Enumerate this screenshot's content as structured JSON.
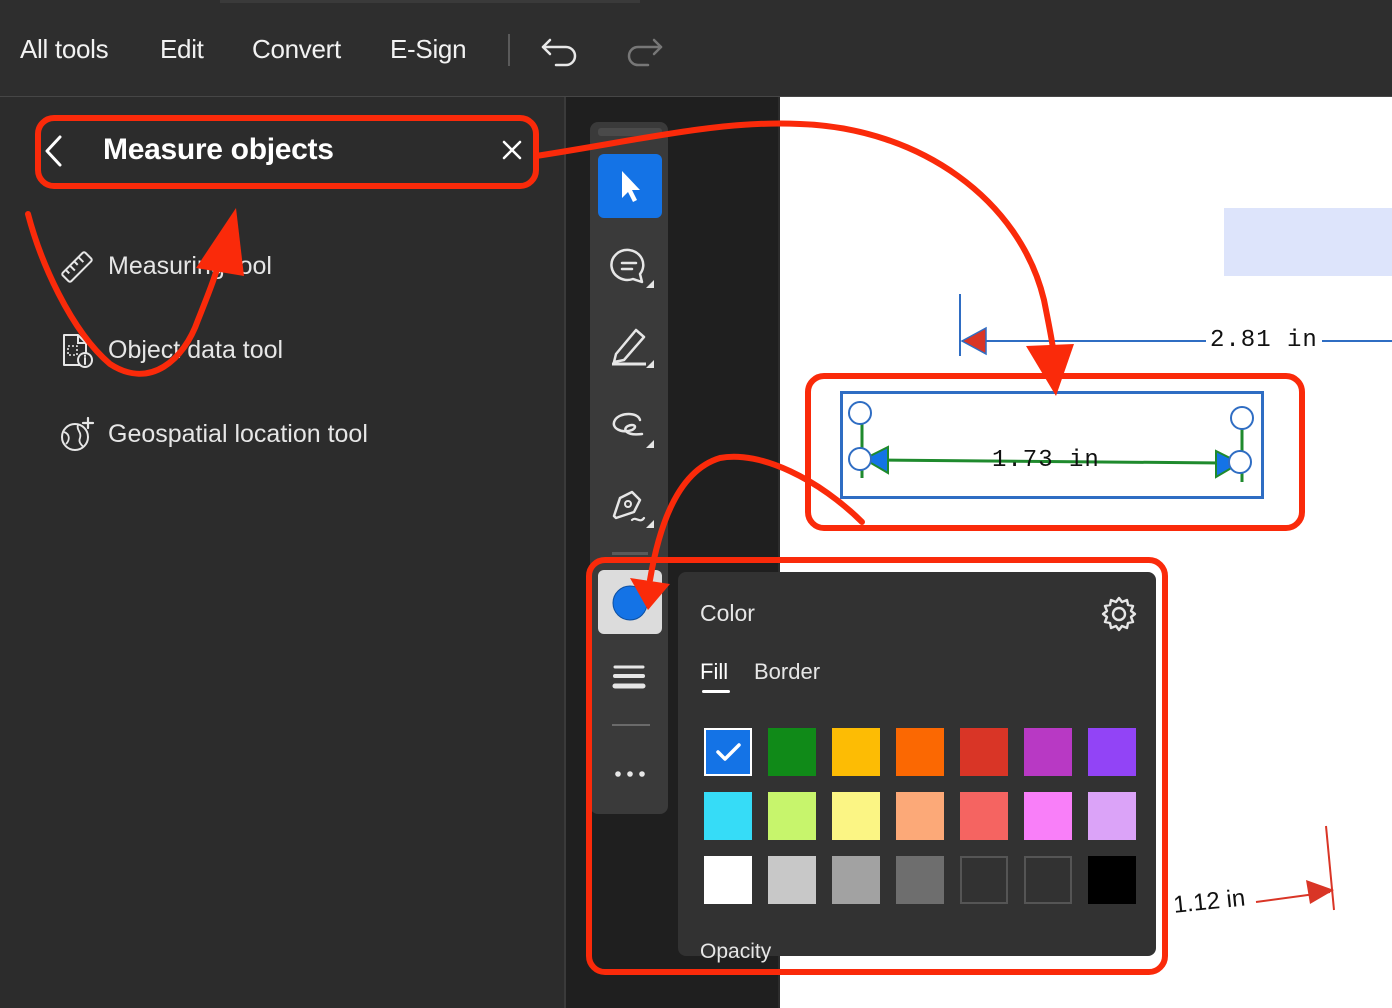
{
  "topbar": {
    "menu": [
      "All tools",
      "Edit",
      "Convert",
      "E-Sign"
    ]
  },
  "panel": {
    "title": "Measure objects",
    "tools": [
      {
        "label": "Measuring tool",
        "icon": "ruler-icon"
      },
      {
        "label": "Object data tool",
        "icon": "object-data-icon"
      },
      {
        "label": "Geospatial location tool",
        "icon": "globe-plus-icon"
      }
    ]
  },
  "toolbar": {
    "tools": [
      "select-icon",
      "comment-icon",
      "highlight-icon",
      "draw-icon",
      "sign-icon",
      "color-icon",
      "line-weight-icon",
      "more-icon"
    ],
    "active_color": "#1473e6"
  },
  "document": {
    "dimensions": [
      "2.81 in",
      "1.73 in",
      "1.12 in"
    ]
  },
  "color_popover": {
    "title": "Color",
    "tabs": [
      "Fill",
      "Border"
    ],
    "active_tab": "Fill",
    "swatches": [
      [
        "#1473e6",
        "#108a18",
        "#fdbc04",
        "#fb6802",
        "#d93526",
        "#b839c4",
        "#9244f6"
      ],
      [
        "#36dcf7",
        "#c7f56c",
        "#fbf584",
        "#fca978",
        "#f56461",
        "#f97ff9",
        "#dba3f8"
      ],
      [
        "#ffffff",
        "#c8c8c8",
        "#a2a2a2",
        "#6e6e6e",
        "none",
        "none",
        "#000000"
      ]
    ],
    "selected_swatch": "#1473e6",
    "opacity_label": "Opacity"
  },
  "colors": {
    "annotation_red": "#fa2a0a",
    "dimension_blue": "#2f6dc3",
    "measure_green": "#1f8a2d"
  }
}
